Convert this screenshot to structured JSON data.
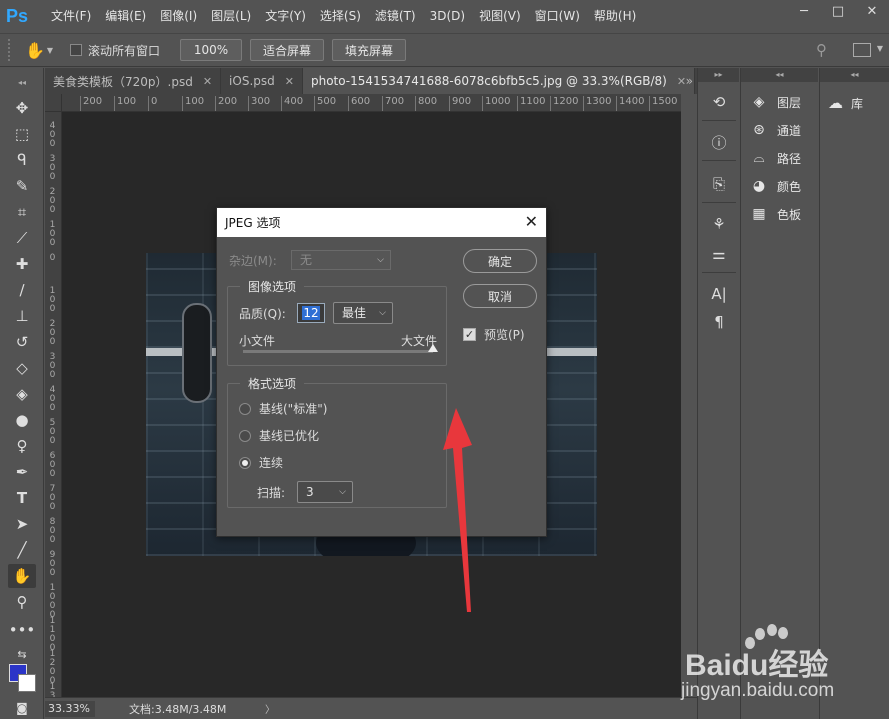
{
  "app": {
    "logo": "Ps"
  },
  "menu": [
    "文件(F)",
    "编辑(E)",
    "图像(I)",
    "图层(L)",
    "文字(Y)",
    "选择(S)",
    "滤镜(T)",
    "3D(D)",
    "视图(V)",
    "窗口(W)",
    "帮助(H)"
  ],
  "window_controls": {
    "minimize": "─",
    "maximize": "□",
    "close": "✕"
  },
  "options_bar": {
    "scroll_all_label": "滚动所有窗口",
    "zoom_button": "100%",
    "fit_screen_button": "适合屏幕",
    "fill_screen_button": "填充屏幕"
  },
  "tabs": [
    {
      "label": "美食类模板（720p）.psd",
      "active": false
    },
    {
      "label": "iOS.psd",
      "active": false
    },
    {
      "label": "photo-1541534741688-6078c6bfb5c5.jpg @ 33.3%(RGB/8)",
      "active": true
    }
  ],
  "tabs_overflow": "»",
  "ruler_h": [
    "200",
    "100",
    "0",
    "100",
    "200",
    "300",
    "400",
    "500",
    "600",
    "700",
    "800",
    "900",
    "1000",
    "1100",
    "1200",
    "1300",
    "1400",
    "1500"
  ],
  "ruler_v": [
    "400",
    "300",
    "200",
    "100",
    "0",
    "100",
    "200",
    "300",
    "400",
    "500",
    "600",
    "700",
    "800",
    "900",
    "1000",
    "1100",
    "1200",
    "1300"
  ],
  "status": {
    "zoom": "33.33%",
    "doc_info": "文档:3.48M/3.48M",
    "arrow": "〉"
  },
  "right_panels": {
    "items": [
      {
        "label": "图层",
        "icon": "layers-icon"
      },
      {
        "label": "通道",
        "icon": "channels-icon"
      },
      {
        "label": "路径",
        "icon": "paths-icon"
      },
      {
        "label": "颜色",
        "icon": "color-icon"
      },
      {
        "label": "色板",
        "icon": "swatches-icon"
      }
    ],
    "library": "库"
  },
  "dialog": {
    "title": "JPEG 选项",
    "matte_label": "杂边(M):",
    "matte_value": "无",
    "image_options_legend": "图像选项",
    "quality_label": "品质(Q):",
    "quality_value": "12",
    "quality_preset": "最佳",
    "small_file": "小文件",
    "large_file": "大文件",
    "quality_level": 1.0,
    "format_legend": "格式选项",
    "format_options": [
      {
        "label": "基线(\"标准\")",
        "checked": false
      },
      {
        "label": "基线已优化",
        "checked": false
      },
      {
        "label": "连续",
        "checked": true
      }
    ],
    "scans_label": "扫描:",
    "scans_value": "3",
    "ok_button": "确定",
    "cancel_button": "取消",
    "preview_label": "预览(P)",
    "preview_checked": true
  },
  "annotation": {
    "arrow_color": "#e8373c"
  },
  "watermark": {
    "brand": "Baidu经验",
    "url": "jingyan.baidu.com"
  },
  "colors": {
    "foreground": "#2b35c8",
    "background": "#ffffff",
    "accent": "#31a8ff"
  }
}
